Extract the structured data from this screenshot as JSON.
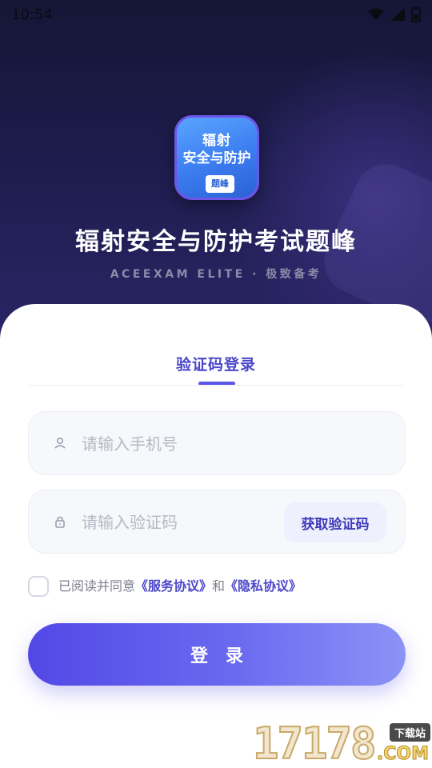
{
  "status_bar": {
    "time": "10:54",
    "icons": [
      "wifi-icon",
      "cellular-signal-icon",
      "battery-icon"
    ]
  },
  "app": {
    "icon_line1": "辐射",
    "icon_line2": "安全与防护",
    "icon_badge": "题峰",
    "title": "辐射安全与防护考试题峰",
    "subtitle": "ACEEXAM ELITE · 极致备考"
  },
  "login": {
    "tab_label": "验证码登录",
    "phone_placeholder": "请输入手机号",
    "code_placeholder": "请输入验证码",
    "get_code_label": "获取验证码",
    "agree_prefix": "已阅读并同意",
    "service_link": "《服务协议》",
    "agree_and": "和",
    "privacy_link": "《隐私协议》",
    "login_label": "登录",
    "agreement_checked": false
  },
  "watermark": {
    "number": "17178",
    "tag": "下载站",
    "com": ".COM"
  },
  "colors": {
    "accent": "#4b47c8",
    "hero_dark": "#151636",
    "button_start": "#5248e6",
    "button_end": "#8b93f6"
  }
}
